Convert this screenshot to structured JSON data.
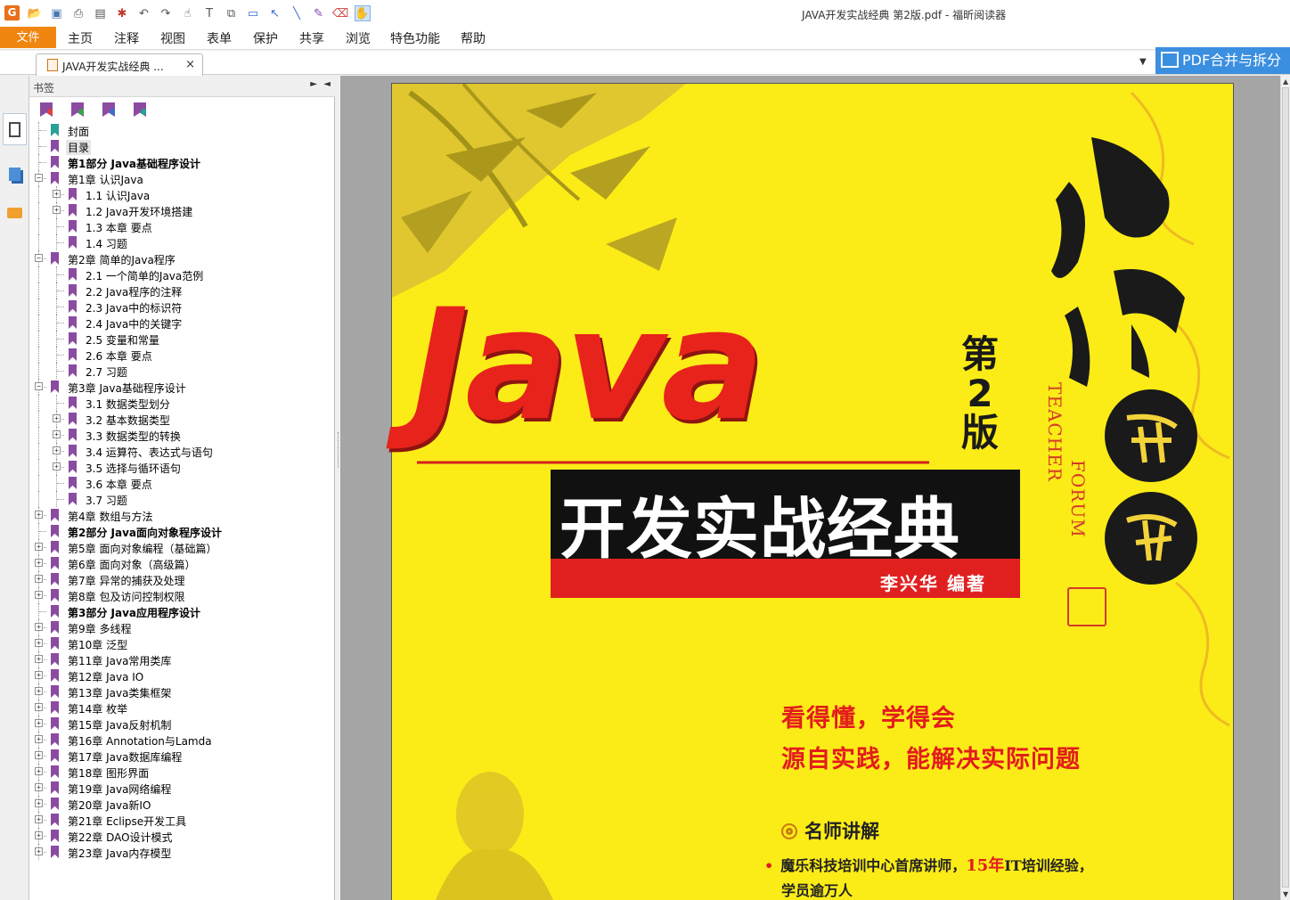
{
  "window": {
    "title": "JAVA开发实战经典 第2版.pdf - 福昕阅读器",
    "logo_text": "G"
  },
  "quick_access": {
    "icons": [
      "open-folder-icon",
      "save-icon",
      "print-icon",
      "scan-icon",
      "new-icon",
      "undo-icon",
      "redo-icon",
      "select-icon",
      "text-select-icon",
      "snapshot-icon",
      "rectangle-icon",
      "arrow-icon",
      "line-icon",
      "pencil-icon",
      "eraser-icon",
      "hand-icon"
    ]
  },
  "menu": {
    "file": "文件",
    "items": [
      "主页",
      "注释",
      "视图",
      "表单",
      "保护",
      "共享",
      "浏览",
      "特色功能",
      "帮助"
    ]
  },
  "tab": {
    "label": "JAVA开发实战经典 ...",
    "close": "×"
  },
  "promo_button": "PDF合并与拆分",
  "bookmark_panel": {
    "title": "书签",
    "pin": "►",
    "collapse": "◄",
    "items": [
      {
        "label": "封面",
        "level": 0,
        "bold": false,
        "expander": "none",
        "color": "teal"
      },
      {
        "label": "目录",
        "level": 0,
        "bold": false,
        "expander": "none",
        "color": "purple",
        "selected": true
      },
      {
        "label": "第1部分 Java基础程序设计",
        "level": 0,
        "bold": true,
        "expander": "none",
        "color": "purple"
      },
      {
        "label": "第1章 认识Java",
        "level": 0,
        "bold": false,
        "expander": "minus",
        "color": "purple"
      },
      {
        "label": "1.1 认识Java",
        "level": 1,
        "bold": false,
        "expander": "plus",
        "color": "purple"
      },
      {
        "label": "1.2 Java开发环境搭建",
        "level": 1,
        "bold": false,
        "expander": "plus",
        "color": "purple"
      },
      {
        "label": "1.3 本章 要点",
        "level": 1,
        "bold": false,
        "expander": "none",
        "color": "purple"
      },
      {
        "label": "1.4 习题",
        "level": 1,
        "bold": false,
        "expander": "none",
        "color": "purple"
      },
      {
        "label": "第2章 简单的Java程序",
        "level": 0,
        "bold": false,
        "expander": "minus",
        "color": "purple"
      },
      {
        "label": "2.1 一个简单的Java范例",
        "level": 1,
        "bold": false,
        "expander": "none",
        "color": "purple"
      },
      {
        "label": "2.2 Java程序的注释",
        "level": 1,
        "bold": false,
        "expander": "none",
        "color": "purple"
      },
      {
        "label": "2.3 Java中的标识符",
        "level": 1,
        "bold": false,
        "expander": "none",
        "color": "purple"
      },
      {
        "label": "2.4 Java中的关键字",
        "level": 1,
        "bold": false,
        "expander": "none",
        "color": "purple"
      },
      {
        "label": "2.5 变量和常量",
        "level": 1,
        "bold": false,
        "expander": "none",
        "color": "purple"
      },
      {
        "label": "2.6 本章 要点",
        "level": 1,
        "bold": false,
        "expander": "none",
        "color": "purple"
      },
      {
        "label": "2.7 习题",
        "level": 1,
        "bold": false,
        "expander": "none",
        "color": "purple"
      },
      {
        "label": "第3章 Java基础程序设计",
        "level": 0,
        "bold": false,
        "expander": "minus",
        "color": "purple"
      },
      {
        "label": "3.1 数据类型划分",
        "level": 1,
        "bold": false,
        "expander": "none",
        "color": "purple"
      },
      {
        "label": "3.2 基本数据类型",
        "level": 1,
        "bold": false,
        "expander": "plus",
        "color": "purple"
      },
      {
        "label": "3.3 数据类型的转换",
        "level": 1,
        "bold": false,
        "expander": "plus",
        "color": "purple"
      },
      {
        "label": "3.4 运算符、表达式与语句",
        "level": 1,
        "bold": false,
        "expander": "plus",
        "color": "purple"
      },
      {
        "label": "3.5 选择与循环语句",
        "level": 1,
        "bold": false,
        "expander": "plus",
        "color": "purple"
      },
      {
        "label": "3.6 本章 要点",
        "level": 1,
        "bold": false,
        "expander": "none",
        "color": "purple"
      },
      {
        "label": "3.7 习题",
        "level": 1,
        "bold": false,
        "expander": "none",
        "color": "purple"
      },
      {
        "label": "第4章 数组与方法",
        "level": 0,
        "bold": false,
        "expander": "plus",
        "color": "purple"
      },
      {
        "label": "第2部分 Java面向对象程序设计",
        "level": 0,
        "bold": true,
        "expander": "none",
        "color": "purple"
      },
      {
        "label": "第5章 面向对象编程（基础篇）",
        "level": 0,
        "bold": false,
        "expander": "plus",
        "color": "purple"
      },
      {
        "label": "第6章 面向对象（高级篇）",
        "level": 0,
        "bold": false,
        "expander": "plus",
        "color": "purple"
      },
      {
        "label": "第7章 异常的捕获及处理",
        "level": 0,
        "bold": false,
        "expander": "plus",
        "color": "purple"
      },
      {
        "label": "第8章 包及访问控制权限",
        "level": 0,
        "bold": false,
        "expander": "plus",
        "color": "purple"
      },
      {
        "label": "第3部分 Java应用程序设计",
        "level": 0,
        "bold": true,
        "expander": "none",
        "color": "purple"
      },
      {
        "label": "第9章 多线程",
        "level": 0,
        "bold": false,
        "expander": "plus",
        "color": "purple"
      },
      {
        "label": "第10章 泛型",
        "level": 0,
        "bold": false,
        "expander": "plus",
        "color": "purple"
      },
      {
        "label": "第11章 Java常用类库",
        "level": 0,
        "bold": false,
        "expander": "plus",
        "color": "purple"
      },
      {
        "label": "第12章 Java IO",
        "level": 0,
        "bold": false,
        "expander": "plus",
        "color": "purple"
      },
      {
        "label": "第13章 Java类集框架",
        "level": 0,
        "bold": false,
        "expander": "plus",
        "color": "purple"
      },
      {
        "label": "第14章 枚举",
        "level": 0,
        "bold": false,
        "expander": "plus",
        "color": "purple"
      },
      {
        "label": "第15章 Java反射机制",
        "level": 0,
        "bold": false,
        "expander": "plus",
        "color": "purple"
      },
      {
        "label": "第16章 Annotation与Lamda",
        "level": 0,
        "bold": false,
        "expander": "plus",
        "color": "purple"
      },
      {
        "label": "第17章 Java数据库编程",
        "level": 0,
        "bold": false,
        "expander": "plus",
        "color": "purple"
      },
      {
        "label": "第18章 图形界面",
        "level": 0,
        "bold": false,
        "expander": "plus",
        "color": "purple"
      },
      {
        "label": "第19章 Java网络编程",
        "level": 0,
        "bold": false,
        "expander": "plus",
        "color": "purple"
      },
      {
        "label": "第20章 Java新IO",
        "level": 0,
        "bold": false,
        "expander": "plus",
        "color": "purple"
      },
      {
        "label": "第21章 Eclipse开发工具",
        "level": 0,
        "bold": false,
        "expander": "plus",
        "color": "purple"
      },
      {
        "label": "第22章 DAO设计模式",
        "level": 0,
        "bold": false,
        "expander": "plus",
        "color": "purple"
      },
      {
        "label": "第23章 Java内存模型",
        "level": 0,
        "bold": false,
        "expander": "plus",
        "color": "purple"
      }
    ]
  },
  "cover": {
    "title": "Java",
    "edition": "第2版",
    "teacher": "TEACHER",
    "forum": "FORUM",
    "subtitle": "开发实战经典",
    "author": "李兴华 编著",
    "tagline_1": "看得懂，学得会",
    "tagline_2": "源自实践，能解决实际问题",
    "feature_title": "名师讲解",
    "feature_bullet": "•",
    "feature_line_1_a": "魔乐科技培训中心首席讲师，",
    "feature_line_1_red": "15年",
    "feature_line_1_b": "IT培训经验，",
    "feature_line_2": "学员逾万人",
    "colors": {
      "background": "#fbec17",
      "title_red": "#e8231c",
      "subtitle_box": "#111111",
      "author_bar": "#e0201f"
    }
  },
  "colors": {
    "accent_orange": "#f0860f",
    "promo_blue": "#3b8fe0",
    "bookmark_purple": "#8a4ba1",
    "bookmark_teal": "#2aa198"
  }
}
